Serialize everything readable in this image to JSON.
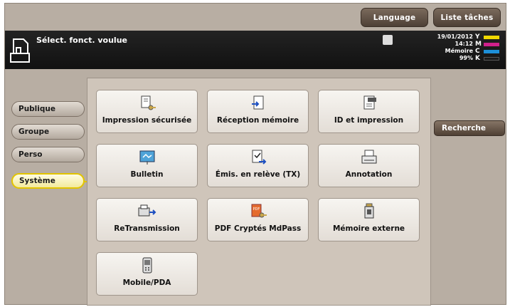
{
  "top_buttons": {
    "language": "Language",
    "liste": "Liste tâches"
  },
  "header": {
    "title": "Sélect. fonct. voulue",
    "date": "19/01/2012",
    "time": "14:12",
    "memory_label": "Mémoire",
    "memory_value": "99%",
    "toner": [
      {
        "letter": "Y",
        "color": "#f0d800"
      },
      {
        "letter": "M",
        "color": "#d0208c"
      },
      {
        "letter": "C",
        "color": "#1d8fd8"
      },
      {
        "letter": "K",
        "color": "#1a1a1a"
      }
    ]
  },
  "tabs": [
    {
      "label": "Publique"
    },
    {
      "label": "Groupe"
    },
    {
      "label": "Perso"
    },
    {
      "label": "Système",
      "active": true
    }
  ],
  "tiles": [
    {
      "label": "Impression sécurisée",
      "icon": "secure-print-icon"
    },
    {
      "label": "Réception mémoire",
      "icon": "memory-receive-icon"
    },
    {
      "label": "ID et impression",
      "icon": "id-print-icon"
    },
    {
      "label": "Bulletin",
      "icon": "bulletin-icon"
    },
    {
      "label": "Émis. en relève (TX)",
      "icon": "polling-tx-icon"
    },
    {
      "label": "Annotation",
      "icon": "annotation-icon"
    },
    {
      "label": "ReTransmission",
      "icon": "retransmission-icon"
    },
    {
      "label": "PDF Cryptés MdPass",
      "icon": "pdf-encrypted-icon"
    },
    {
      "label": "Mémoire externe",
      "icon": "external-memory-icon"
    },
    {
      "label": "Mobile/PDA",
      "icon": "mobile-pda-icon"
    }
  ],
  "right": {
    "recherche": "Recherche"
  }
}
